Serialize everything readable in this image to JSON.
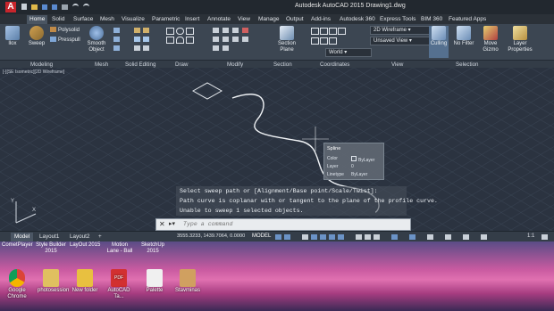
{
  "window": {
    "title": "Autodesk AutoCAD 2015      Drawing1.dwg",
    "app_icon_letter": "A"
  },
  "ribbon_tabs": [
    "Home",
    "Solid",
    "Surface",
    "Mesh",
    "Visualize",
    "Parametric",
    "Insert",
    "Annotate",
    "View",
    "Manage",
    "Output",
    "Add-ins",
    "Autodesk 360",
    "Express Tools",
    "BIM 360",
    "Featured Apps"
  ],
  "active_tab": "Home",
  "ribbon": {
    "box": "llox",
    "sweep": "Sweep",
    "polysolid": "Polysolid",
    "presspull": "Presspull",
    "smooth_object": "Smooth Object",
    "section_plane": "Section Plane",
    "visual_style": "2D Wireframe",
    "unsaved_view": "Unsaved View",
    "world": "World",
    "culling": "Culling",
    "no_filter": "No Filter",
    "move_gizmo": "Move Gizmo",
    "layer_properties": "Layer Properties"
  },
  "panel_labels": [
    "Modeling",
    "Mesh",
    "Solid Editing",
    "Draw",
    "Modify",
    "Section",
    "Coordinates",
    "View",
    "Selection"
  ],
  "viewport": {
    "label": "[-][SE Isometric][2D Wireframe]",
    "ucs_x": "X",
    "ucs_y": "Y"
  },
  "quick_properties": {
    "title": "Spline",
    "color_label": "Color",
    "color_value": "ByLayer",
    "layer_label": "Layer",
    "layer_value": "0",
    "linetype_label": "Linetype",
    "linetype_value": "ByLayer"
  },
  "command_history": [
    "Select sweep path or [Alignment/Base point/Scale/Twist]:",
    "Path curve is coplanar with or tangent to the plane of the profile curve.",
    "Unable to sweep 1 selected objects."
  ],
  "command_input": {
    "placeholder": "Type a command"
  },
  "layout_tabs": [
    "Model",
    "Layout1",
    "Layout2"
  ],
  "active_layout": "Model",
  "status": {
    "coordinates": "3555.3233, 1439.7064, 0.0000",
    "model": "MODEL",
    "scale": "1:1"
  },
  "desktop_top_labels": [
    "CometPlayer",
    "Style Builder 2015",
    "LayOut 2015",
    "Motion Lane - Ball",
    "SketchUp 2015"
  ],
  "desktop_icons": [
    {
      "label": "Google Chrome",
      "color": "#4a8af0"
    },
    {
      "label": "photosession",
      "color": "#e0c060"
    },
    {
      "label": "New folder",
      "color": "#e8c040"
    },
    {
      "label": "AutoCAD Ta...",
      "color": "#d23030"
    },
    {
      "label": "Palette",
      "color": "#f0f0f0"
    },
    {
      "label": "Stavminas",
      "color": "#d0a060"
    }
  ]
}
